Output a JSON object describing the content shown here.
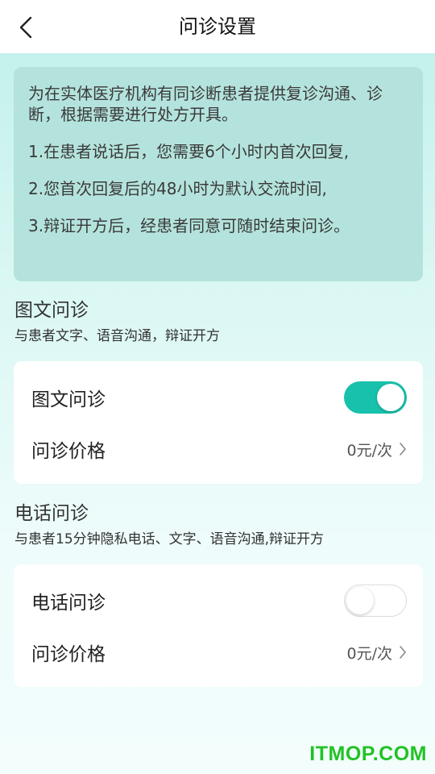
{
  "header": {
    "title": "问诊设置"
  },
  "notice": {
    "lines": [
      "为在实体医疗机构有同诊断患者提供复诊沟通、诊断，根据需要进行处方开具。",
      "1.在患者说话后，您需要6个小时内首次回复,",
      "2.您首次回复后的48小时为默认交流时间,",
      "3.辩证开方后，经患者同意可随时结束问诊。"
    ]
  },
  "sections": [
    {
      "title": "图文问诊",
      "subtitle": "与患者文字、语音沟通，辩证开方",
      "toggle_label": "图文问诊",
      "toggle_on": true,
      "price_label": "问诊价格",
      "price_value": "0元/次"
    },
    {
      "title": "电话问诊",
      "subtitle": "与患者15分钟隐私电话、文字、语音沟通,辩证开方",
      "toggle_label": "电话问诊",
      "toggle_on": false,
      "price_label": "问诊价格",
      "price_value": "0元/次"
    }
  ],
  "colors": {
    "accent": "#17c1ac",
    "notice_bg": "#b4e3dd"
  },
  "watermark": "ITMOP.COM"
}
